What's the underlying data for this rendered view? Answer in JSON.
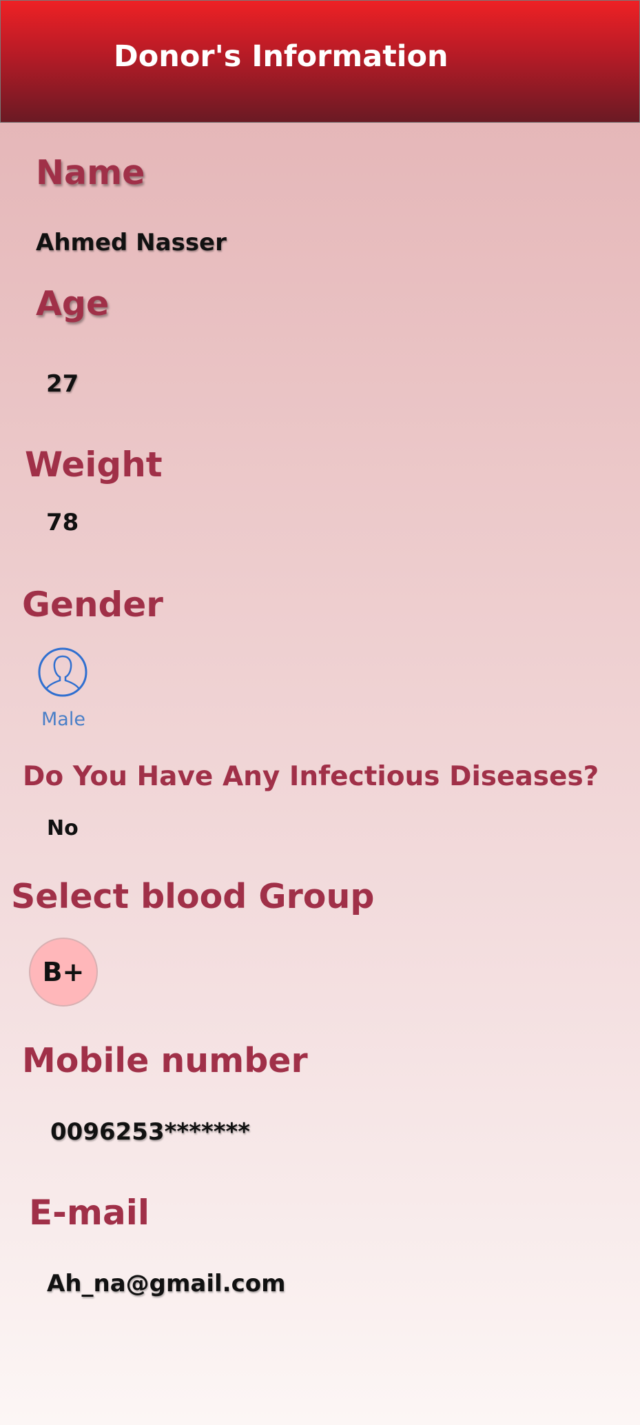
{
  "header": {
    "title": "Donor's Information"
  },
  "name": {
    "label": "Name",
    "value": "Ahmed Nasser"
  },
  "age": {
    "label": "Age",
    "value": "27"
  },
  "weight": {
    "label": "Weight",
    "value": "78"
  },
  "gender": {
    "label": "Gender",
    "value": "Male",
    "icon": "person-outline-icon"
  },
  "diseases": {
    "label": "Do You Have Any Infectious Diseases?",
    "value": "No"
  },
  "blood_group": {
    "label": "Select blood Group",
    "value": "B+"
  },
  "mobile": {
    "label": "Mobile number",
    "value": "0096253*******"
  },
  "email": {
    "label": "E-mail",
    "value": "Ah_na@gmail.com"
  },
  "colors": {
    "header_top": "#ee2125",
    "header_bottom": "#6a1a24",
    "label": "#a03048",
    "badge": "#ffb7ba",
    "gender_caption": "#4a7fc7"
  }
}
